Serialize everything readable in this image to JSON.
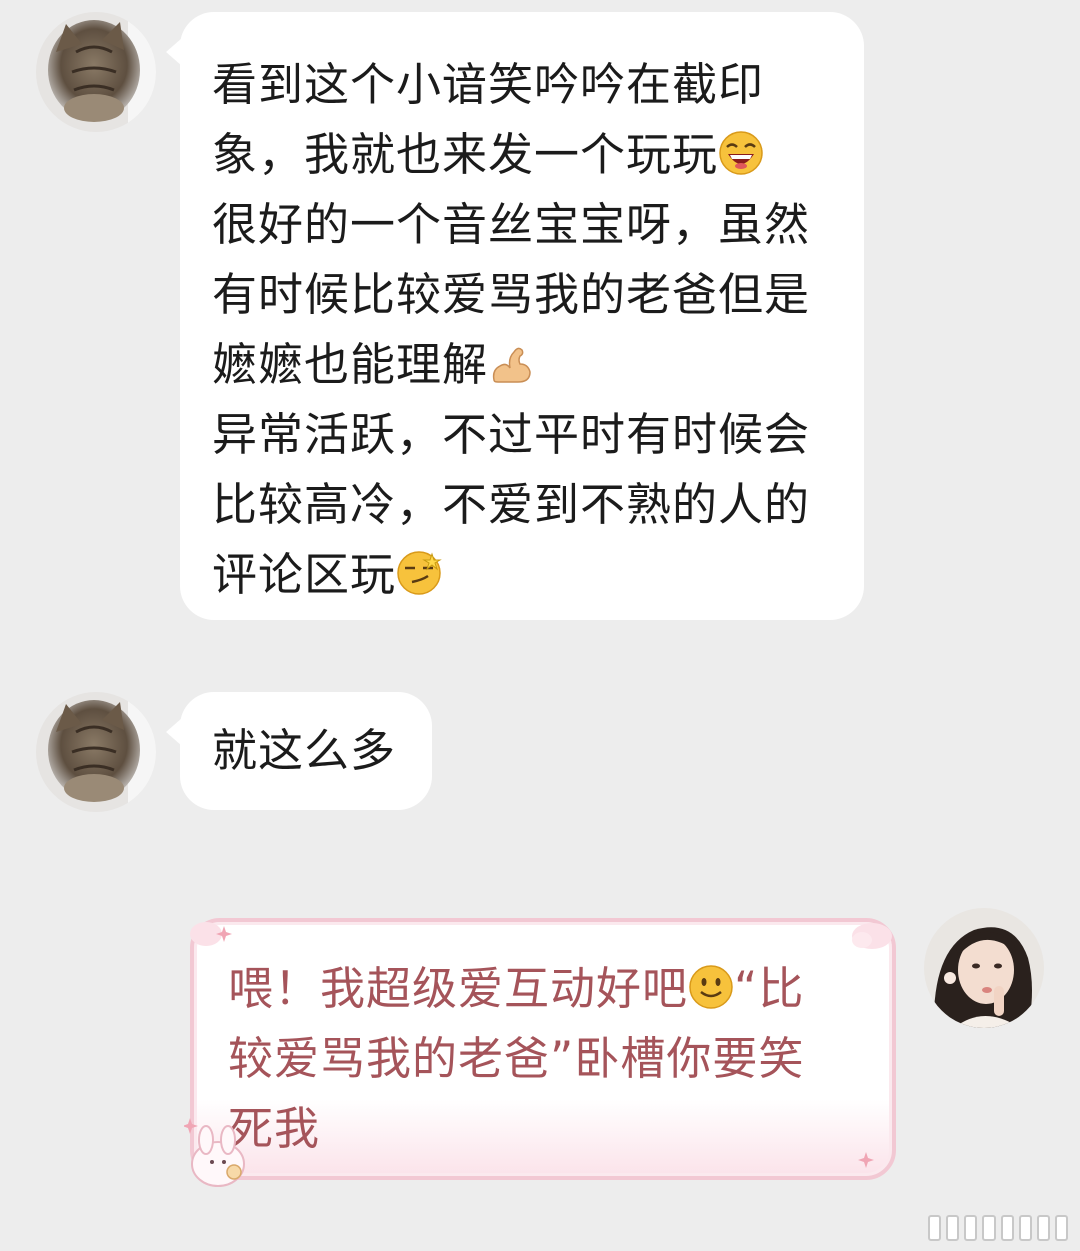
{
  "chat": {
    "messages": [
      {
        "sender": "other",
        "avatar_icon": "cat-avatar-icon",
        "lines": [
          "看到这个小谙笑吟吟在截印",
          "象，我就也来发一个玩玩",
          "很好的一个音丝宝宝呀，虽然",
          "有时候比较爱骂我的老爸但是",
          "嬷嬷也能理解",
          "异常活跃，不过平时有时候会",
          "比较高冷，不爱到不熟的人的",
          "评论区玩"
        ],
        "emojis": [
          "laughing-emoji-icon",
          "flexed-biceps-emoji-icon",
          "smirking-emoji-icon"
        ]
      },
      {
        "sender": "other",
        "avatar_icon": "cat-avatar-icon",
        "text": "就这么多"
      },
      {
        "sender": "self",
        "avatar_icon": "girl-avatar-icon",
        "lines": [
          "喂！我超级爱互动好吧",
          "“比",
          "较爱骂我的老爸”卧槽你要笑",
          "死我"
        ],
        "emojis": [
          "slight-smile-emoji-icon"
        ]
      }
    ]
  },
  "colors": {
    "background": "#ededed",
    "bubble_other": "#ffffff",
    "bubble_self_text": "#a5545a",
    "bubble_self_border": "#f2c8d3"
  }
}
